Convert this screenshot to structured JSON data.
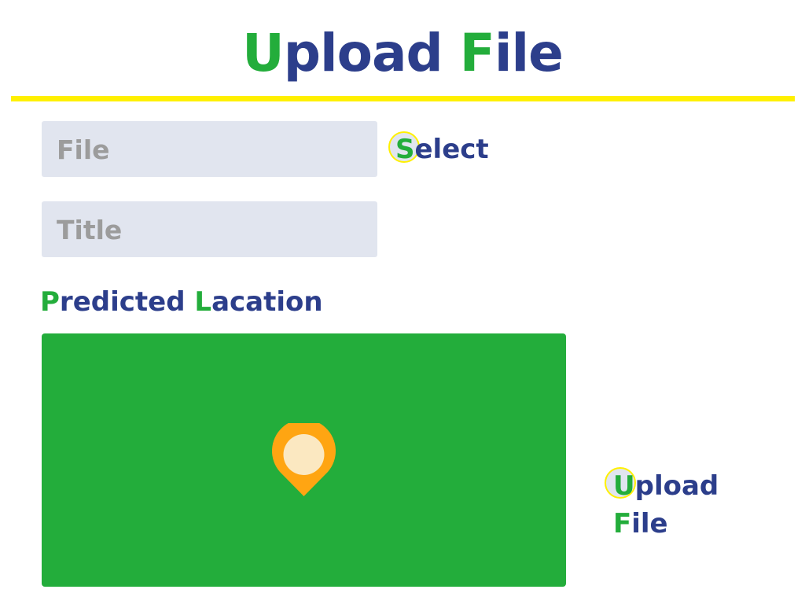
{
  "header": {
    "title_first_letter_1": "U",
    "title_rest_1": "pload",
    "title_first_letter_2": "F",
    "title_rest_2": "ile"
  },
  "form": {
    "file_placeholder": "File",
    "title_placeholder": "Title",
    "select_button": {
      "first_letter": "S",
      "rest": "elect"
    }
  },
  "location": {
    "label_first_letter_1": "P",
    "label_rest_1": "redicted",
    "label_first_letter_2": "L",
    "label_rest_2": "acation",
    "marker_icon": "map-pin-icon"
  },
  "upload_button": {
    "first_letter_1": "U",
    "rest_1": "pload",
    "first_letter_2": "F",
    "rest_2": "ile"
  },
  "colors": {
    "accent_green": "#23ad3b",
    "text_blue": "#2c3e8b",
    "divider_yellow": "#fff000",
    "field_bg": "#e1e5ef",
    "pin_orange": "#ffa512",
    "pin_inner": "#fbe8c1"
  }
}
